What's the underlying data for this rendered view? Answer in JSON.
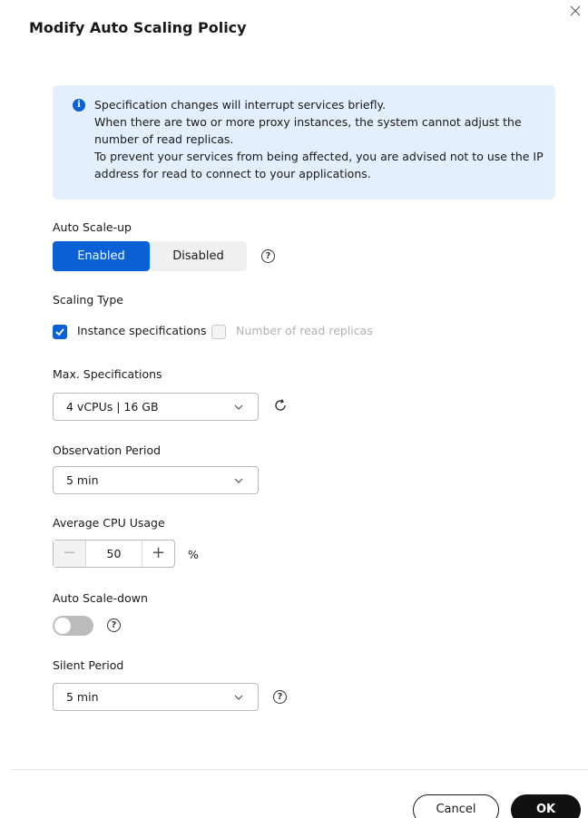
{
  "dialog": {
    "title": "Modify Auto Scaling Policy"
  },
  "alert": {
    "icon": "info-icon",
    "lines": [
      "Specification changes will interrupt services briefly.",
      "When there are two or more proxy instances, the system cannot adjust the",
      "number of read replicas.",
      "To prevent your services from being affected, you are advised not to use the IP",
      "address for read to connect to your applications."
    ]
  },
  "auto_scale_up": {
    "label": "Auto Scale-up",
    "options": [
      "Enabled",
      "Disabled"
    ],
    "selected": "Enabled"
  },
  "scaling_type": {
    "label": "Scaling Type",
    "options": [
      {
        "label": "Instance specifications",
        "checked": true,
        "disabled": false
      },
      {
        "label": "Number of read replicas",
        "checked": false,
        "disabled": true
      }
    ]
  },
  "max_specifications": {
    "label": "Max. Specifications",
    "value": "4 vCPUs | 16 GB"
  },
  "observation_period": {
    "label": "Observation Period",
    "value": "5 min"
  },
  "average_cpu_usage": {
    "label": "Average CPU Usage",
    "value": "50",
    "minus": "−",
    "plus": "+",
    "unit": "%"
  },
  "auto_scale_down": {
    "label": "Auto Scale-down",
    "enabled": false
  },
  "silent_period": {
    "label": "Silent Period",
    "value": "5 min"
  },
  "footer": {
    "cancel_label": "Cancel",
    "ok_label": "OK"
  },
  "help_glyph": "?",
  "info_glyph": "i",
  "colors": {
    "primary": "#0a61d6",
    "alert_bg": "#e3effd",
    "ok_button": "#111111"
  }
}
